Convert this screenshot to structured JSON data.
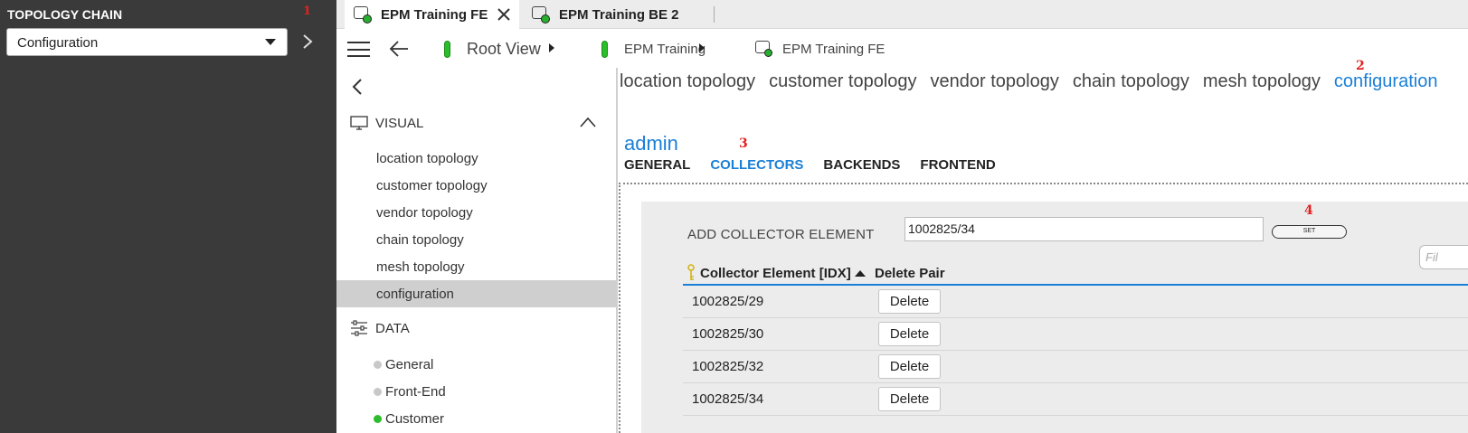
{
  "left_panel": {
    "title": "TOPOLOGY CHAIN",
    "annotation_1": "1",
    "select_value": "Configuration"
  },
  "tabs": [
    {
      "label": "EPM Training FE",
      "active": true
    },
    {
      "label": "EPM Training BE 2",
      "active": false
    }
  ],
  "breadcrumbs": {
    "root": "Root View",
    "level1": "EPM Training",
    "level2": "EPM Training FE"
  },
  "sidenav": {
    "visual_label": "VISUAL",
    "visual_items": [
      "location topology",
      "customer topology",
      "vendor topology",
      "chain topology",
      "mesh topology",
      "configuration"
    ],
    "selected_item": "configuration",
    "data_label": "DATA",
    "data_items": [
      {
        "label": "General",
        "status": "grey"
      },
      {
        "label": "Front-End",
        "status": "grey"
      },
      {
        "label": "Customer",
        "status": "green"
      }
    ]
  },
  "topology_tabs": {
    "items": [
      "location topology",
      "customer topology",
      "vendor topology",
      "chain topology",
      "mesh topology",
      "configuration"
    ],
    "active": "configuration",
    "annotation_2": "2"
  },
  "admin_title": "admin",
  "annotation_3": "3",
  "sub_tabs": {
    "items": [
      "GENERAL",
      "COLLECTORS",
      "BACKENDS",
      "FRONTEND"
    ],
    "active": "COLLECTORS"
  },
  "collector_form": {
    "add_label": "ADD COLLECTOR ELEMENT",
    "input_value": "1002825/34",
    "annotation_4": "4",
    "set_label": "SET",
    "filter_placeholder": "Fil"
  },
  "table": {
    "headers": [
      "Collector Element [IDX]",
      "Delete Pair"
    ],
    "rows": [
      "1002825/29",
      "1002825/30",
      "1002825/32",
      "1002825/34"
    ],
    "delete_label": "Delete"
  },
  "colors": {
    "accent_blue": "#1a7fd6",
    "annotation_red": "#e32020",
    "status_green": "#2bbd2b",
    "left_panel_bg": "#3a3a3a"
  }
}
